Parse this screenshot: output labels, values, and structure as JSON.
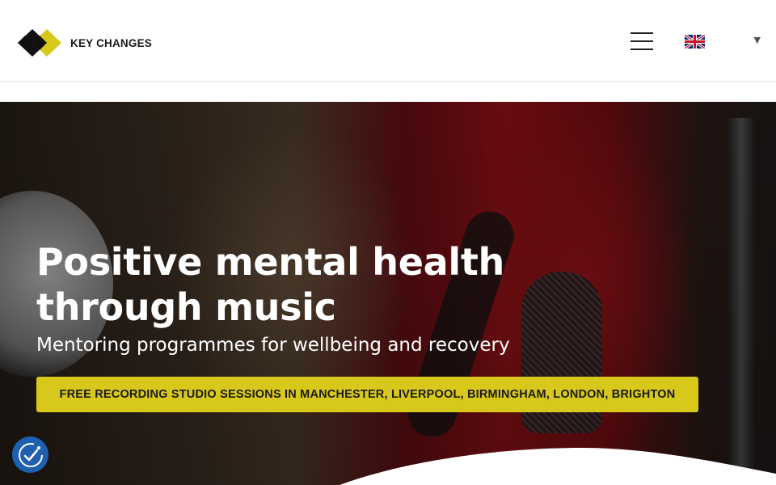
{
  "brand": {
    "name": "KEY CHANGES",
    "colors": {
      "accent": "#d8c81c",
      "logo_dark": "#111111",
      "accessibility_blue": "#1f5fb0"
    }
  },
  "header": {
    "menu_icon": "hamburger-menu-icon",
    "language": {
      "flag_icon": "uk-flag-icon",
      "dropdown_icon": "caret-down-icon"
    }
  },
  "hero": {
    "title_line1": "Positive mental health",
    "title_line2": "through music",
    "subtitle": "Mentoring programmes for wellbeing and recovery",
    "cta_label": "FREE RECORDING STUDIO SESSIONS IN MANCHESTER, LIVERPOOL, BIRMINGHAM, LONDON, BRIGHTON"
  },
  "accessibility": {
    "icon": "accessibility-icon"
  }
}
